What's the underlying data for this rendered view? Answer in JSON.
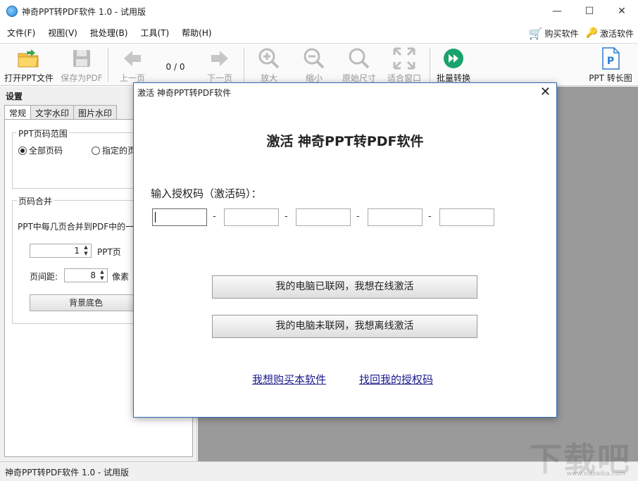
{
  "window": {
    "title": "神奇PPT转PDF软件 1.0 - 试用版",
    "minimize": "—",
    "maximize": "☐",
    "close": "✕"
  },
  "menu": {
    "items": [
      "文件(F)",
      "视图(V)",
      "批处理(B)",
      "工具(T)",
      "帮助(H)"
    ],
    "buy": "购买软件",
    "activate": "激活软件"
  },
  "toolbar": {
    "open": "打开PPT文件",
    "save": "保存为PDF",
    "prev": "上一页",
    "page_count": "0 / 0",
    "next": "下一页",
    "zoom_in": "放大",
    "zoom_out": "缩小",
    "original_size": "原始尺寸",
    "fit_window": "适合窗口",
    "batch": "批量转换",
    "ppt_long": "PPT 转长图"
  },
  "settings": {
    "title": "设置",
    "tabs": [
      "常规",
      "文字水印",
      "图片水印"
    ],
    "page_range_title": "PPT页码范围",
    "radio_all": "全部页码",
    "radio_specified": "指定的页",
    "merge_title": "页码合并",
    "merge_desc": "PPT中每几页合并到PDF中的一页",
    "pages_value": "1",
    "pages_unit": "PPT页",
    "spacing_label": "页间距:",
    "spacing_value": "8",
    "spacing_unit": "像素",
    "bg_button": "背景底色"
  },
  "status": {
    "text": "神奇PPT转PDF软件 1.0 - 试用版"
  },
  "watermark": {
    "main": "下载吧",
    "sub": "www.xiazaiba.com"
  },
  "dialog": {
    "title": "激活 神奇PPT转PDF软件",
    "heading": "激活 神奇PPT转PDF软件",
    "prompt": "输入授权码（激活码）：",
    "code_values": [
      "",
      "",
      "",
      "",
      ""
    ],
    "online_button": "我的电脑已联网，我想在线激活",
    "offline_button": "我的电脑未联网，我想离线激活",
    "buy_link": "我想购买本软件",
    "recover_link": "找回我的授权码"
  },
  "colors": {
    "accent": "#2b6cb3",
    "workspace": "#9a9a9a",
    "link": "#1a1a8c"
  }
}
